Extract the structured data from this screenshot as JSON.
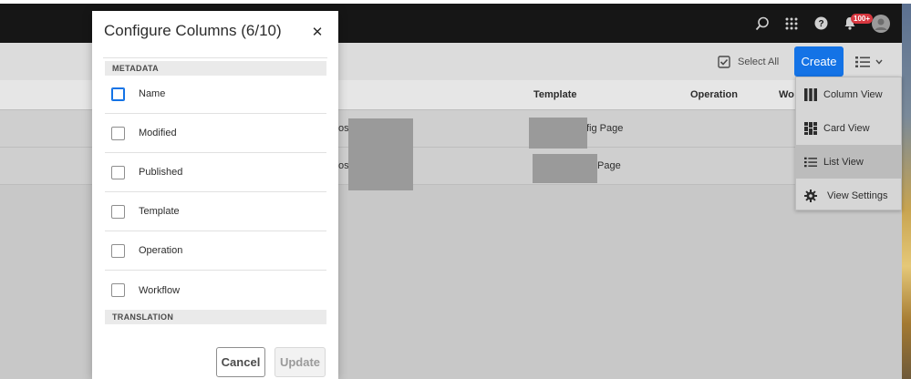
{
  "header": {
    "notification_badge": "100+",
    "icons": [
      "search-icon",
      "apps-grid-icon",
      "help-icon",
      "bell-icon",
      "avatar"
    ]
  },
  "actionbar": {
    "select_all": "Select All",
    "create": "Create"
  },
  "list": {
    "columns": [
      "Template",
      "Operation",
      "Wo"
    ],
    "rows": [
      {
        "title_fragment": "osc",
        "template_fragment": "fig Page"
      },
      {
        "title_fragment": "oso",
        "template_fragment": "Page"
      }
    ]
  },
  "view_menu": {
    "items": [
      {
        "label": "Column View",
        "icon": "column-view-icon"
      },
      {
        "label": "Card View",
        "icon": "card-view-icon"
      },
      {
        "label": "List View",
        "icon": "list-view-icon"
      },
      {
        "label": "View Settings",
        "icon": "gear-icon"
      }
    ],
    "selected": "List View"
  },
  "modal": {
    "title": "Configure Columns (6/10)",
    "section_metadata": "METADATA",
    "options": [
      "Name",
      "Modified",
      "Published",
      "Template",
      "Operation",
      "Workflow"
    ],
    "section_translation": "TRANSLATION",
    "cancel": "Cancel",
    "update": "Update"
  },
  "colors": {
    "accent": "#1473e6",
    "header_bg": "#161616",
    "badge": "#d7373f"
  }
}
